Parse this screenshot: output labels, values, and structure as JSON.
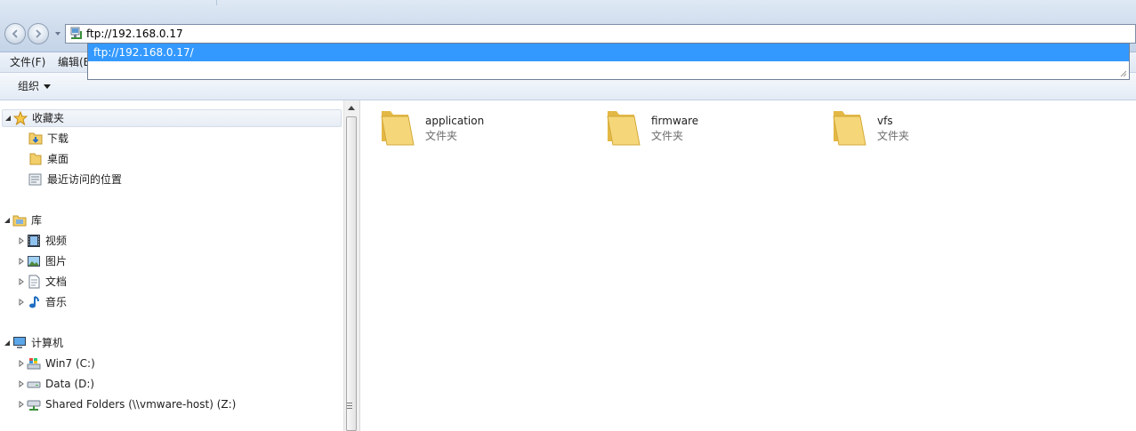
{
  "address_bar": {
    "value": "ftp://192.168.0.17",
    "suggestion": "ftp://192.168.0.17/"
  },
  "menu": {
    "file": "文件(F)",
    "edit": "编辑(E"
  },
  "toolbar": {
    "organize": "组织"
  },
  "nav": {
    "favorites": {
      "label": "收藏夹",
      "items": [
        {
          "label": "下载",
          "icon": "download-folder-icon"
        },
        {
          "label": "桌面",
          "icon": "desktop-folder-icon"
        },
        {
          "label": "最近访问的位置",
          "icon": "recent-places-icon"
        }
      ]
    },
    "libraries": {
      "label": "库",
      "items": [
        {
          "label": "视频",
          "icon": "video-library-icon"
        },
        {
          "label": "图片",
          "icon": "picture-library-icon"
        },
        {
          "label": "文档",
          "icon": "document-library-icon"
        },
        {
          "label": "音乐",
          "icon": "music-library-icon"
        }
      ]
    },
    "computer": {
      "label": "计算机",
      "items": [
        {
          "label": "Win7 (C:)",
          "icon": "system-drive-icon"
        },
        {
          "label": "Data (D:)",
          "icon": "drive-icon"
        },
        {
          "label": "Shared Folders (\\\\vmware-host) (Z:)",
          "icon": "network-drive-icon"
        }
      ]
    }
  },
  "content": {
    "items": [
      {
        "name": "application",
        "type": "文件夹"
      },
      {
        "name": "firmware",
        "type": "文件夹"
      },
      {
        "name": "vfs",
        "type": "文件夹"
      }
    ]
  },
  "colors": {
    "selection": "#3399ff",
    "folder": "#f5d77a"
  }
}
